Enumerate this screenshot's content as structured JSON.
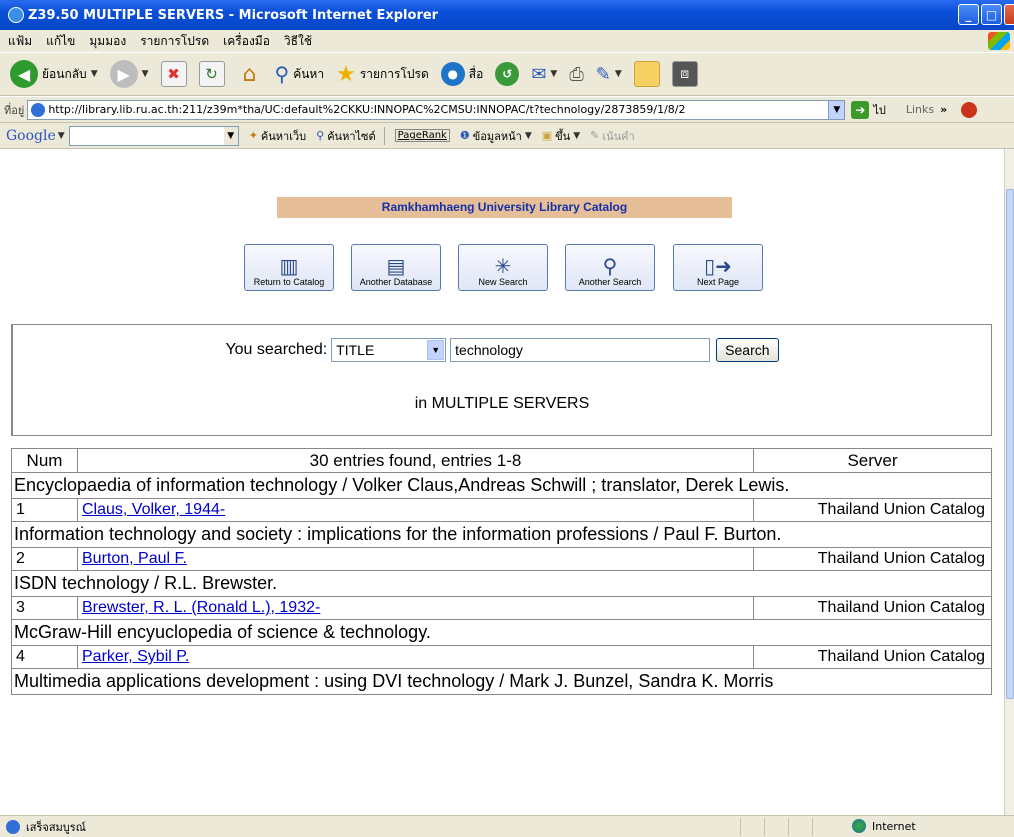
{
  "window": {
    "title": "Z39.50 MULTIPLE SERVERS - Microsoft Internet Explorer",
    "controls": [
      "minimize",
      "maximize",
      "close"
    ]
  },
  "menu": [
    "แฟ้ม",
    "แก้ไข",
    "มุมมอง",
    "รายการโปรด",
    "เครื่องมือ",
    "วิธีใช้"
  ],
  "toolbar": {
    "back_label": "ย้อนกลับ",
    "search_label": "ค้นหา",
    "favorites_label": "รายการโปรด",
    "media_label": "สื่อ"
  },
  "address": {
    "label": "ที่อยู่",
    "url": "http://library.lib.ru.ac.th:211/z39m*tha/UC:default%2CKKU:INNOPAC%2CMSU:INNOPAC/t?technology/2873859/1/8/2",
    "go_label": "ไป",
    "links_label": "Links"
  },
  "googlebar": {
    "logo": "Google",
    "search_web": "ค้นหาเว็บ",
    "search_site": "ค้นหาไซต์",
    "pagerank": "PageRank",
    "page_info": "ข้อมูลหน้า",
    "up": "ขึ้น",
    "highlight": "เน้นคำ"
  },
  "page": {
    "banner": "Ramkhamhaeng University Library Catalog",
    "nav_buttons": [
      {
        "label": "Return to Catalog",
        "icon": "books-icon"
      },
      {
        "label": "Another Database",
        "icon": "book-icon"
      },
      {
        "label": "New Search",
        "icon": "sparkle-icon"
      },
      {
        "label": "Another Search",
        "icon": "magnifier-icon"
      },
      {
        "label": "Next Page",
        "icon": "next-page-icon"
      }
    ],
    "search": {
      "label": "You searched:",
      "field": "TITLE",
      "term": "technology",
      "button": "Search",
      "scope": "in MULTIPLE SERVERS"
    },
    "results": {
      "headers": {
        "num": "Num",
        "summary": "30 entries found, entries 1-8",
        "server": "Server"
      },
      "entries": [
        {
          "title": "Encyclopaedia of information technology / Volker Claus,Andreas Schwill ; translator, Derek Lewis.",
          "num": "1",
          "author": "Claus, Volker, 1944-",
          "server": "Thailand Union Catalog"
        },
        {
          "title": "Information technology and society : implications for the information professions / Paul F. Burton.",
          "num": "2",
          "author": "Burton, Paul F.",
          "server": "Thailand Union Catalog"
        },
        {
          "title": "ISDN technology / R.L. Brewster.",
          "num": "3",
          "author": "Brewster, R. L. (Ronald L.), 1932-",
          "server": "Thailand Union Catalog"
        },
        {
          "title": "McGraw-Hill encyuclopedia of science & technology.",
          "num": "4",
          "author": "Parker, Sybil P.",
          "server": "Thailand Union Catalog"
        },
        {
          "title": "Multimedia applications development : using DVI technology / Mark J. Bunzel, Sandra K. Morris",
          "num": "",
          "author": "",
          "server": ""
        }
      ]
    }
  },
  "status": {
    "text": "เสร็จสมบูรณ์",
    "zone": "Internet"
  }
}
